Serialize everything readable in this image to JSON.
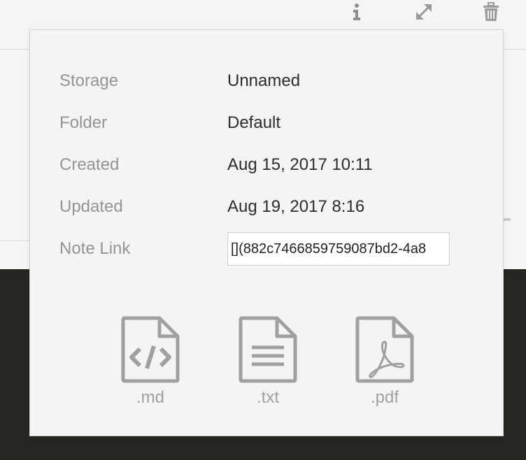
{
  "info_panel": {
    "rows": [
      {
        "label": "Storage",
        "value": "Unnamed"
      },
      {
        "label": "Folder",
        "value": "Default"
      },
      {
        "label": "Created",
        "value": "Aug 15, 2017 10:11"
      },
      {
        "label": "Updated",
        "value": "Aug 19, 2017 8:16"
      }
    ],
    "note_link": {
      "label": "Note Link",
      "value": "[](882c7466859759087bd2-4a8"
    },
    "exports": [
      {
        "label": ".md",
        "icon": "markdown-file-icon"
      },
      {
        "label": ".txt",
        "icon": "text-file-icon"
      },
      {
        "label": ".pdf",
        "icon": "pdf-file-icon"
      }
    ]
  },
  "toolbar": {
    "icons": [
      "info-icon",
      "fullscreen-icon",
      "trash-icon"
    ]
  },
  "colors": {
    "panel_bg": "#f4f4f4",
    "label": "#949494",
    "value": "#2c2c2c",
    "icon": "#a0a0a0",
    "dark_bg": "#262622"
  }
}
